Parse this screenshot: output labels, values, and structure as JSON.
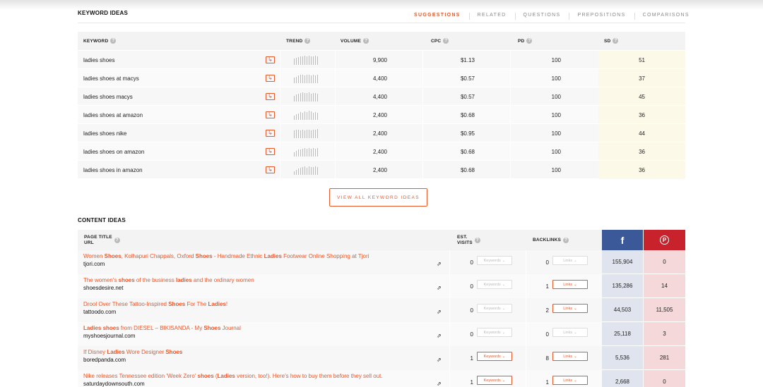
{
  "keyword_ideas": {
    "title": "KEYWORD IDEAS",
    "tabs": [
      "SUGGESTIONS",
      "RELATED",
      "QUESTIONS",
      "PREPOSITIONS",
      "COMPARISONS"
    ],
    "active_tab": "SUGGESTIONS",
    "headers": {
      "keyword": "KEYWORD",
      "trend": "TREND",
      "volume": "VOLUME",
      "cpc": "CPC",
      "pd": "PD",
      "sd": "SD"
    },
    "rows": [
      {
        "keyword": "ladies shoes",
        "volume": "9,900",
        "cpc": "$1.13",
        "pd": "100",
        "sd": "51"
      },
      {
        "keyword": "ladies shoes at macys",
        "volume": "4,400",
        "cpc": "$0.57",
        "pd": "100",
        "sd": "37"
      },
      {
        "keyword": "ladies shoes macys",
        "volume": "4,400",
        "cpc": "$0.57",
        "pd": "100",
        "sd": "45"
      },
      {
        "keyword": "ladies shoes at amazon",
        "volume": "2,400",
        "cpc": "$0.68",
        "pd": "100",
        "sd": "36"
      },
      {
        "keyword": "ladies shoes nike",
        "volume": "2,400",
        "cpc": "$0.95",
        "pd": "100",
        "sd": "44"
      },
      {
        "keyword": "ladies shoes on amazon",
        "volume": "2,400",
        "cpc": "$0.68",
        "pd": "100",
        "sd": "36"
      },
      {
        "keyword": "ladies shoes in amazon",
        "volume": "2,400",
        "cpc": "$0.68",
        "pd": "100",
        "sd": "36"
      }
    ],
    "view_all_label": "VIEW ALL KEYWORD IDEAS"
  },
  "content_ideas": {
    "title": "CONTENT IDEAS",
    "headers": {
      "page_title": "PAGE TITLE",
      "url": "URL",
      "est": "EST.",
      "visits": "VISITS",
      "backlinks": "BACKLINKS",
      "facebook": "f",
      "pinterest": "P"
    },
    "keywords_label": "Keywords",
    "links_label": "Links",
    "rows": [
      {
        "title_html": "Women <b>Shoes</b>, Kolhapuri Chappals, Oxford <b>Shoes</b> - Handmade Ethnic <b>Ladies</b> Footwear Online Shopping at Tjori",
        "url": "tjori.com",
        "visits": "0",
        "backlinks": "0",
        "facebook": "155,904",
        "pinterest": "0",
        "kw_active": false,
        "links_active": false
      },
      {
        "title_html": "The women's <b>shoes</b> of the business <b>ladies</b> and the ordinary women",
        "url": "shoesdesire.net",
        "visits": "0",
        "backlinks": "1",
        "facebook": "135,286",
        "pinterest": "14",
        "kw_active": false,
        "links_active": true
      },
      {
        "title_html": "Drool Over These Tattoo-Inspired <b>Shoes</b> For The <b>Ladies</b>!",
        "url": "tattoodo.com",
        "visits": "0",
        "backlinks": "2",
        "facebook": "44,503",
        "pinterest": "11,505",
        "kw_active": false,
        "links_active": true
      },
      {
        "title_html": "<b>Ladies shoes</b> from DIESEL – BIKISANDA - My <b>Shoes</b> Journal",
        "url": "myshoesjournal.com",
        "visits": "0",
        "backlinks": "0",
        "facebook": "25,118",
        "pinterest": "3",
        "kw_active": false,
        "links_active": false
      },
      {
        "title_html": "If Disney <b>Ladies</b> Wore Designer <b>Shoes</b>",
        "url": "boredpanda.com",
        "visits": "1",
        "backlinks": "8",
        "facebook": "5,536",
        "pinterest": "281",
        "kw_active": true,
        "links_active": true
      },
      {
        "title_html": "Nike releases Tennessee edition 'Week Zero' <b>shoes</b> (<b>Ladies</b> version, too!). Here's how to buy them before they sell out.",
        "url": "saturdaydownsouth.com",
        "visits": "1",
        "backlinks": "1",
        "facebook": "2,668",
        "pinterest": "0",
        "kw_active": true,
        "links_active": true
      }
    ]
  },
  "colors": {
    "accent": "#e8582b",
    "facebook": "#3b5998",
    "pinterest": "#c8232c",
    "sd_column": "#fdf9e9"
  }
}
